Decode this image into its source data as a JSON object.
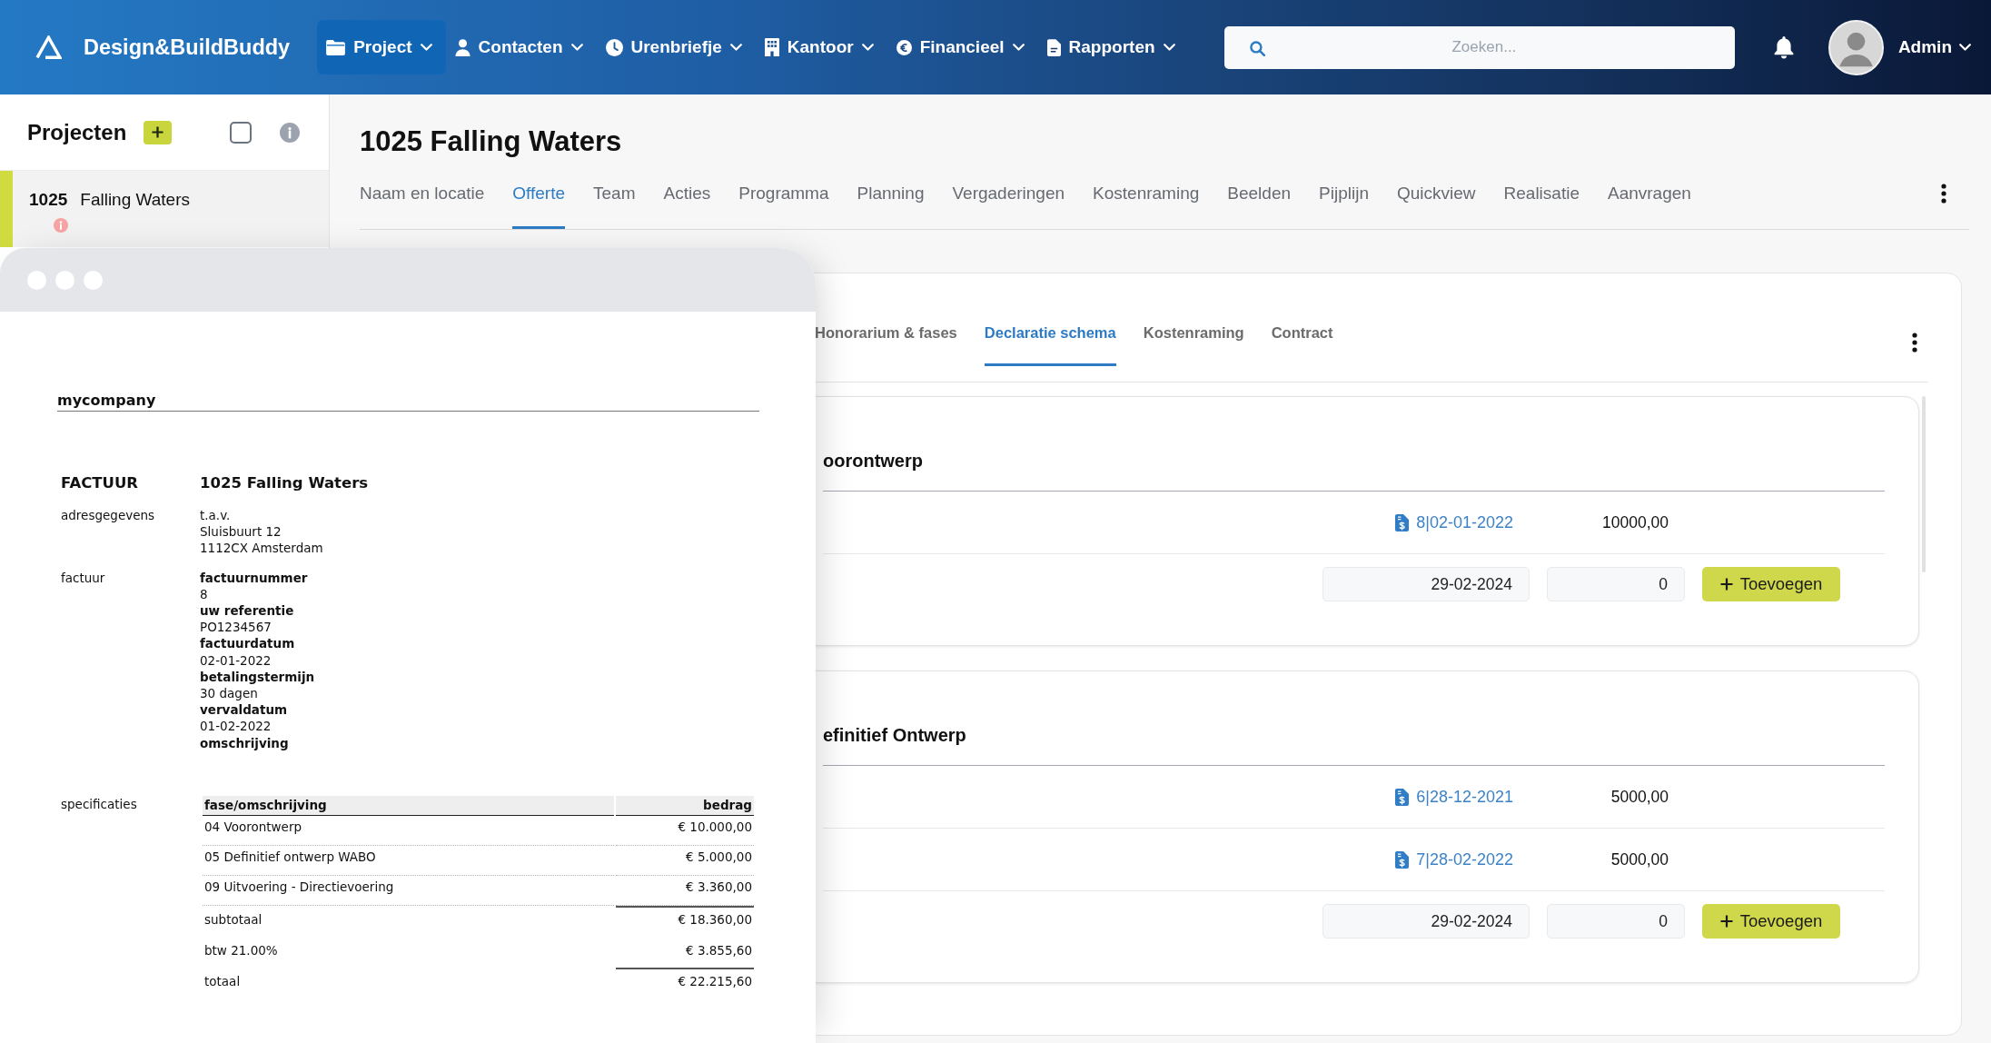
{
  "header": {
    "brand": "Design&BuildBuddy",
    "menu": [
      {
        "label": "Project",
        "selected": true
      },
      {
        "label": "Contacten",
        "selected": false
      },
      {
        "label": "Urenbriefje",
        "selected": false
      },
      {
        "label": "Kantoor",
        "selected": false
      },
      {
        "label": "Financieel",
        "selected": false
      },
      {
        "label": "Rapporten",
        "selected": false
      }
    ],
    "search": {
      "placeholder": "Zoeken..."
    },
    "user": {
      "name": "Admin"
    }
  },
  "sidebar": {
    "title": "Projecten",
    "select_all": {
      "checked": false
    },
    "projects": [
      {
        "number": "1025",
        "name": "Falling Waters",
        "selected": true,
        "alert": true
      }
    ]
  },
  "project": {
    "title": "1025 Falling Waters",
    "tabs": [
      {
        "label": "Naam en locatie",
        "selected": false
      },
      {
        "label": "Offerte",
        "selected": true
      },
      {
        "label": "Team",
        "selected": false
      },
      {
        "label": "Acties",
        "selected": false
      },
      {
        "label": "Programma",
        "selected": false
      },
      {
        "label": "Planning",
        "selected": false
      },
      {
        "label": "Vergaderingen",
        "selected": false
      },
      {
        "label": "Kostenraming",
        "selected": false
      },
      {
        "label": "Beelden",
        "selected": false
      },
      {
        "label": "Pijplijn",
        "selected": false
      },
      {
        "label": "Quickview",
        "selected": false
      },
      {
        "label": "Realisatie",
        "selected": false
      },
      {
        "label": "Aanvragen",
        "selected": false
      }
    ]
  },
  "offerte": {
    "tabs": [
      {
        "label": "Honorarium & fases",
        "selected": false
      },
      {
        "label": "Declaratie schema",
        "selected": true
      },
      {
        "label": "Kostenraming",
        "selected": false
      },
      {
        "label": "Contract",
        "selected": false
      }
    ],
    "phases": [
      {
        "title": "oorontwerp",
        "declarations": [
          {
            "invoice": "8|02-01-2022",
            "amount": "10000,00"
          }
        ],
        "new_entry": {
          "date": "29-02-2024",
          "amount": "0",
          "button": "Toevoegen"
        }
      },
      {
        "title": "efinitief Ontwerp",
        "declarations": [
          {
            "invoice": "6|28-12-2021",
            "amount": "5000,00"
          },
          {
            "invoice": "7|28-02-2022",
            "amount": "5000,00"
          }
        ],
        "new_entry": {
          "date": "29-02-2024",
          "amount": "0",
          "button": "Toevoegen"
        }
      }
    ]
  },
  "document_window": {
    "company": "mycompany",
    "heading": "FACTUUR",
    "title": "1025 Falling Waters",
    "address": {
      "label": "adresgegevens",
      "lines": [
        "t.a.v.",
        "Sluisbuurt 12",
        "1112CX Amsterdam"
      ]
    },
    "invoice": {
      "label": "factuur",
      "fields": [
        {
          "label": "factuurnummer",
          "value": "8"
        },
        {
          "label": "uw referentie",
          "value": "PO1234567"
        },
        {
          "label": "factuurdatum",
          "value": "02-01-2022"
        },
        {
          "label": "betalingstermijn",
          "value": "30 dagen"
        },
        {
          "label": "vervaldatum",
          "value": "01-02-2022"
        },
        {
          "label": "omschrijving"
        }
      ]
    },
    "specifications": {
      "label": "specificaties",
      "columns": [
        "fase/omschrijving",
        "bedrag"
      ],
      "rows": [
        {
          "description": "04 Voorontwerp",
          "amount": "€ 10.000,00"
        },
        {
          "description": "05 Definitief ontwerp WABO",
          "amount": "€ 5.000,00"
        },
        {
          "description": "09 Uitvoering - Directievoering",
          "amount": "€ 3.360,00"
        }
      ],
      "totals": [
        {
          "label": "subtotaal",
          "amount": "€ 18.360,00",
          "rule_above": true
        },
        {
          "label": "btw 21.00%",
          "amount": "€ 3.855,60",
          "rule_above": false
        },
        {
          "label": "totaal",
          "amount": "€ 22.215,60",
          "rule_above": true
        }
      ]
    }
  }
}
